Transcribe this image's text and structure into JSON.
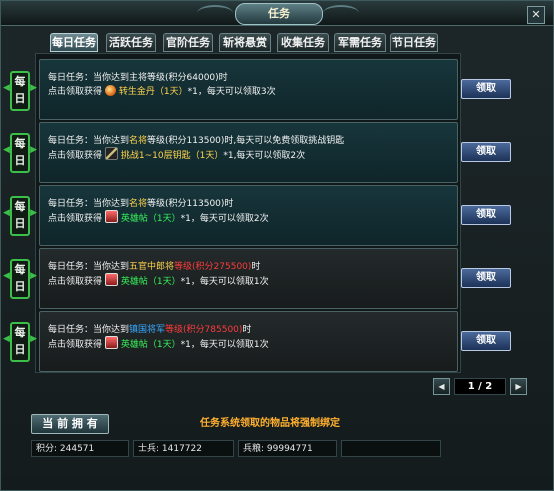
{
  "window": {
    "title": "任务",
    "close_label": "✕"
  },
  "tabs": [
    {
      "label": "每日任务",
      "active": true
    },
    {
      "label": "活跃任务",
      "active": false
    },
    {
      "label": "官阶任务",
      "active": false
    },
    {
      "label": "斩将悬赏",
      "active": false
    },
    {
      "label": "收集任务",
      "active": false
    },
    {
      "label": "军需任务",
      "active": false
    },
    {
      "label": "节日任务",
      "active": false
    }
  ],
  "quests": [
    {
      "badge": "每日",
      "line1": {
        "prefix": "每日任务：当你达到主将等级(积分64000)时",
        "hl": "",
        "suffix": "",
        "hl2": "",
        "suffix2": ""
      },
      "line2": {
        "prefix": "点击领取获得",
        "icon": "orb-item-icon",
        "item": "转生金丹（1天）",
        "suffix": "*1，每天可以领取3次"
      },
      "button": "领取",
      "style": "teal"
    },
    {
      "badge": "每日",
      "line1": {
        "prefix": "每日任务：当你达到",
        "hl": "名将",
        "suffix": "等级(积分113500)时,每天可以免费领取挑战钥匙",
        "hl2": "",
        "suffix2": ""
      },
      "line2": {
        "prefix": "点击领取获得",
        "icon": "key-item-icon",
        "item": "挑战1~10层钥匙（1天）",
        "suffix": "*1,每天可以领取2次"
      },
      "button": "领取",
      "style": "teal"
    },
    {
      "badge": "每日",
      "line1": {
        "prefix": "每日任务：当你达到",
        "hl": "名将",
        "suffix": "等级(积分113500)时",
        "hl2": "",
        "suffix2": ""
      },
      "line2": {
        "prefix": "点击领取获得",
        "icon": "hero-card-icon",
        "item": "英雄帖（1天）",
        "suffix": "*1，每天可以领取2次"
      },
      "button": "领取",
      "style": "teal"
    },
    {
      "badge": "每日",
      "line1": {
        "prefix": "每日任务：当你达到",
        "hl": "五官中郎将",
        "suffix": "",
        "hl2": "等级(积分275500)",
        "suffix2": "时"
      },
      "line2": {
        "prefix": "点击领取获得",
        "icon": "hero-card-icon",
        "item": "英雄帖（1天）",
        "suffix": "*1，每天可以领取1次"
      },
      "button": "领取",
      "style": "gray"
    },
    {
      "badge": "每日",
      "line1": {
        "prefix": "每日任务：当你达到",
        "hl": "镇国将军",
        "suffix": "",
        "hl2": "等级(积分785500)",
        "suffix2": "时"
      },
      "line2": {
        "prefix": "点击领取获得",
        "icon": "hero-card-icon",
        "item": "英雄帖（1天）",
        "suffix": "*1，每天可以领取1次"
      },
      "button": "领取",
      "style": "gray"
    }
  ],
  "pager": {
    "prev": "◀",
    "next": "▶",
    "text": "1 / 2",
    "current": 1,
    "total": 2
  },
  "footer": {
    "own_button": "当 前 拥 有",
    "notice": "任务系统领取的物品将强制绑定",
    "stats": [
      {
        "text": "积分: 244571"
      },
      {
        "text": "士兵: 1417722"
      },
      {
        "text": "兵粮: 99994771"
      },
      {
        "text": ""
      }
    ]
  },
  "colors": {
    "highlight_gold": "#ffd34d",
    "highlight_green": "#36f25a",
    "highlight_red": "#ff3b3b",
    "highlight_blue": "#36a8ff",
    "badge_green": "#3bbf48"
  }
}
